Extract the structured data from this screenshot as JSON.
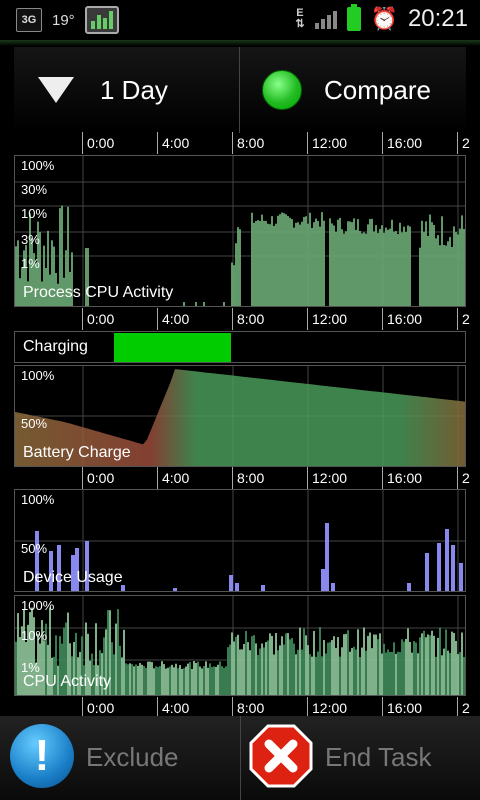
{
  "statusbar": {
    "network": "3G",
    "temperature": "19°",
    "edge": "E",
    "time": "20:21",
    "icons": [
      "network-3g-icon",
      "app-monitor-icon",
      "data-arrows-icon",
      "signal-icon",
      "battery-icon",
      "alarm-icon"
    ]
  },
  "toolbar": {
    "range_label": "1 Day",
    "compare_label": "Compare",
    "compare_color": "#22bb22"
  },
  "time_ticks": [
    "0:00",
    "4:00",
    "8:00",
    "12:00",
    "16:00",
    "2"
  ],
  "panels": {
    "process_cpu": {
      "label": "Process CPU Activity",
      "y_labels": [
        "100%",
        "30%",
        "10%",
        "3%",
        "1%"
      ]
    },
    "charging": {
      "label": "Charging",
      "color": "#00cc00"
    },
    "battery": {
      "label": "Battery Charge",
      "y_labels": [
        "100%",
        "50%"
      ]
    },
    "usage": {
      "label": "Device Usage",
      "y_labels": [
        "100%",
        "50%"
      ],
      "color": "#8888ee"
    },
    "cpu": {
      "label": "CPU Activity",
      "y_labels": [
        "100%",
        "10%",
        "1%"
      ]
    }
  },
  "bottom": {
    "exclude_label": "Exclude",
    "end_task_label": "End Task"
  }
}
